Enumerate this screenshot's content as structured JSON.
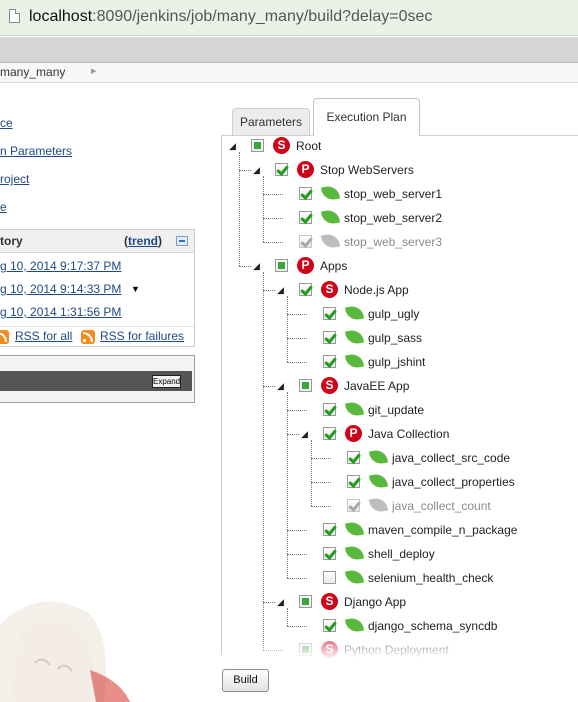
{
  "browser": {
    "url_host": "localhost",
    "url_rest": ":8090/jenkins/job/many_many/build?delay=0sec"
  },
  "breadcrumb": {
    "job": "many_many"
  },
  "sidebar": {
    "links": [
      "ce",
      "n Parameters",
      "roject",
      "e"
    ]
  },
  "build_history": {
    "title": "tory",
    "trend_label": "trend",
    "builds": [
      "g 10, 2014 9:17:37 PM",
      "g 10, 2014 9:14:33 PM",
      "g 10, 2014 1:31:56 PM"
    ],
    "rss_all": "RSS for all",
    "rss_failures": "RSS for failures"
  },
  "executor": {
    "expand_label": "Expand"
  },
  "tabs": {
    "parameters": "Parameters",
    "execution_plan": "Execution Plan"
  },
  "tree": [
    {
      "label": "Root",
      "type": "S",
      "check": "partial",
      "disabled": false
    },
    {
      "label": "Stop WebServers",
      "type": "P",
      "check": "checked",
      "disabled": false
    },
    {
      "label": "stop_web_server1",
      "type": "leaf",
      "check": "checked",
      "disabled": false
    },
    {
      "label": "stop_web_server2",
      "type": "leaf",
      "check": "checked",
      "disabled": false
    },
    {
      "label": "stop_web_server3",
      "type": "leaf",
      "check": "checked",
      "disabled": true
    },
    {
      "label": "Apps",
      "type": "P",
      "check": "partial",
      "disabled": false
    },
    {
      "label": "Node.js App",
      "type": "S",
      "check": "checked",
      "disabled": false
    },
    {
      "label": "gulp_ugly",
      "type": "leaf",
      "check": "checked",
      "disabled": false
    },
    {
      "label": "gulp_sass",
      "type": "leaf",
      "check": "checked",
      "disabled": false
    },
    {
      "label": "gulp_jshint",
      "type": "leaf",
      "check": "checked",
      "disabled": false
    },
    {
      "label": "JavaEE App",
      "type": "S",
      "check": "partial",
      "disabled": false
    },
    {
      "label": "git_update",
      "type": "leaf",
      "check": "checked",
      "disabled": false
    },
    {
      "label": "Java Collection",
      "type": "P",
      "check": "checked",
      "disabled": false
    },
    {
      "label": "java_collect_src_code",
      "type": "leaf",
      "check": "checked",
      "disabled": false
    },
    {
      "label": "java_collect_properties",
      "type": "leaf",
      "check": "checked",
      "disabled": false
    },
    {
      "label": "java_collect_count",
      "type": "leaf",
      "check": "checked",
      "disabled": true
    },
    {
      "label": "maven_compile_n_package",
      "type": "leaf",
      "check": "checked",
      "disabled": false
    },
    {
      "label": "shell_deploy",
      "type": "leaf",
      "check": "checked",
      "disabled": false
    },
    {
      "label": "selenium_health_check",
      "type": "leaf",
      "check": "unchecked",
      "disabled": false
    },
    {
      "label": "Django App",
      "type": "S",
      "check": "partial",
      "disabled": false
    },
    {
      "label": "django_schema_syncdb",
      "type": "leaf",
      "check": "checked",
      "disabled": false
    },
    {
      "label": "Python Deployment",
      "type": "S",
      "check": "partial",
      "disabled": false
    }
  ],
  "build_button": "Build",
  "colors": {
    "address_bar": "#eaf2e8",
    "check_green": "#1e9a1e",
    "leaf_green": "#59b83c",
    "badge_red": "#d0021b",
    "link_blue": "#204a87"
  },
  "icons": {
    "S": "sequential-icon",
    "P": "parallel-icon",
    "leaf": "job-leaf-icon"
  }
}
